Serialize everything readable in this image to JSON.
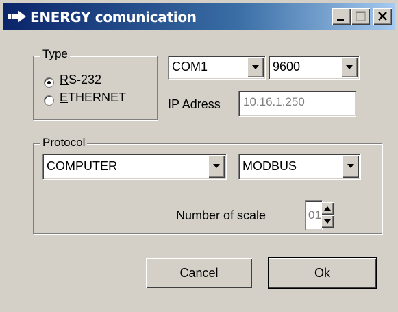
{
  "window": {
    "title": "ENERGY comunication",
    "controls": {
      "minimize_icon": "minimize-icon",
      "maximize_icon": "maximize-icon",
      "close_icon": "close-icon"
    }
  },
  "type_group": {
    "label": "Type",
    "options": [
      {
        "hotkey": "R",
        "rest": "S-232",
        "selected": true
      },
      {
        "hotkey": "E",
        "rest": "THERNET",
        "selected": false
      }
    ]
  },
  "port": {
    "selected": "COM1"
  },
  "baud": {
    "selected": "9600"
  },
  "ip": {
    "label": "IP Adress",
    "value": "10.16.1.250"
  },
  "protocol_group": {
    "label": "Protocol",
    "device": {
      "selected": "COMPUTER"
    },
    "protocol": {
      "selected": "MODBUS"
    },
    "scale_label": "Number of scale",
    "scale_value": "01"
  },
  "buttons": {
    "cancel": "Cancel",
    "ok_hotkey": "O",
    "ok_rest": "k"
  },
  "colors": {
    "face": "#d4d0c8",
    "title_start": "#0a246a",
    "title_end": "#a6caf0"
  }
}
